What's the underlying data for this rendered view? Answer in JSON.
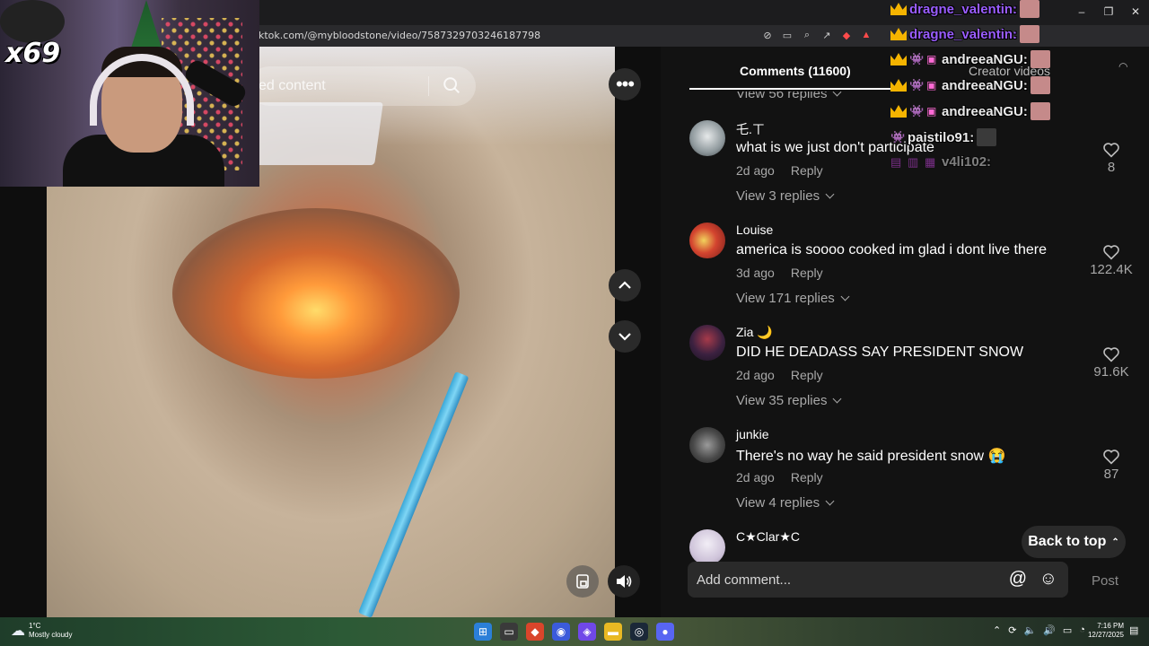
{
  "browser": {
    "url": "ktok.com/@mybloodstone/video/7587329703246187798",
    "window_controls": [
      "–",
      "❐",
      "✕"
    ]
  },
  "webcam": {
    "overlay_text": "x69"
  },
  "video": {
    "search_placeholder": "ed content"
  },
  "panel": {
    "tab_comments": "Comments (11600)",
    "tab_creator": "Creator videos",
    "top_view_replies": "View 56 replies",
    "comments": [
      {
        "user": "乇.ㄒ",
        "text": "what is we just don't participate",
        "age": "2d ago",
        "reply": "Reply",
        "likes": "8",
        "view_replies": "View 3 replies",
        "avatar_color": "#9aa4a8"
      },
      {
        "user": "Louise",
        "text": "america is soooo cooked im glad i dont live there",
        "age": "3d ago",
        "reply": "Reply",
        "likes": "122.4K",
        "view_replies": "View 171 replies",
        "avatar_color": "#c23b2d"
      },
      {
        "user": "Zia 🌙",
        "text": "DID HE DEADASS SAY PRESIDENT SNOW",
        "age": "2d ago",
        "reply": "Reply",
        "likes": "91.6K",
        "view_replies": "View 35 replies",
        "avatar_color": "#3a2b3f"
      },
      {
        "user": "junkie",
        "text": "There's no way he said president snow 😭",
        "age": "2d ago",
        "reply": "Reply",
        "likes": "87",
        "view_replies": "View 4 replies",
        "avatar_color": "#4a4a4a"
      },
      {
        "user": "C★Clar★C",
        "avatar_color": "#d8d0e0"
      }
    ],
    "back_to_top": "Back to top",
    "add_comment_placeholder": "Add comment...",
    "post_label": "Post"
  },
  "chat": [
    {
      "name": "dragne_valentin:",
      "style": "purple",
      "badges": [
        "crown"
      ]
    },
    {
      "name": "dragne_valentin:",
      "style": "purple",
      "badges": [
        "crown"
      ]
    },
    {
      "name": "andreeaNGU:",
      "style": "white",
      "badges": [
        "crown",
        "invader",
        "gift"
      ]
    },
    {
      "name": "andreeaNGU:",
      "style": "white",
      "badges": [
        "crown",
        "invader",
        "gift"
      ]
    },
    {
      "name": "andreeaNGU:",
      "style": "white",
      "badges": [
        "crown",
        "invader",
        "gift"
      ]
    },
    {
      "name": "paistilo91:",
      "style": "white",
      "badges": [
        "invader"
      ]
    },
    {
      "name": "v4li102:",
      "style": "white",
      "badges": []
    }
  ],
  "taskbar": {
    "weather_temp": "1°C",
    "weather_desc": "Mostly cloudy",
    "time": "7:16 PM",
    "date": "12/27/2025"
  }
}
